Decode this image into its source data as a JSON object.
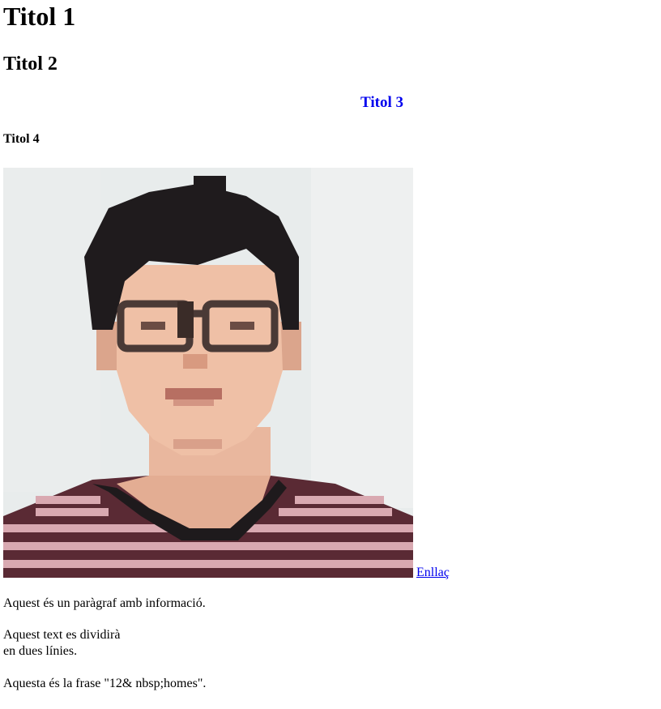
{
  "headings": {
    "h1": "Titol 1",
    "h2": "Titol 2",
    "h3": "Titol 3",
    "h4": "Titol 4"
  },
  "image": {
    "icon": "portrait-photo"
  },
  "link": {
    "label": "Enllaç"
  },
  "paragraphs": {
    "p1": "Aquest és un paràgraf amb informació.",
    "p2_line1": "Aquest text es dividirà",
    "p2_line2": "en dues línies.",
    "p3": "Aquesta és la frase \"12& nbsp;homes\"."
  },
  "colors": {
    "link": "#0000ee",
    "heading3": "#0000ee"
  }
}
